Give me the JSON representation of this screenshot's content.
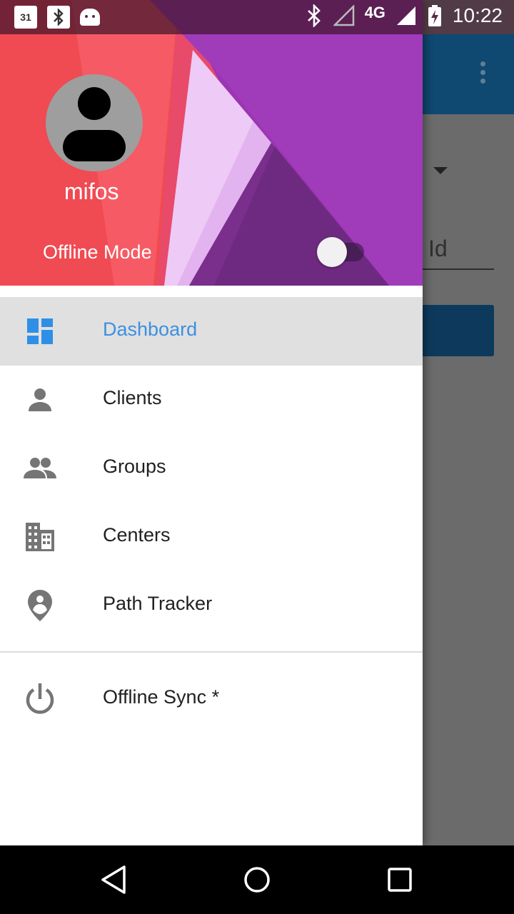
{
  "status_bar": {
    "time": "10:22",
    "network": "4G",
    "left_icons": [
      "calendar-icon",
      "bluetooth-icon",
      "android-icon"
    ],
    "calendar_day": "31",
    "bluetooth_glyph": "✱"
  },
  "background_app": {
    "input_text": "Id"
  },
  "drawer": {
    "header": {
      "username": "mifos",
      "offline_mode_label": "Offline Mode",
      "offline_mode_enabled": false
    },
    "items": [
      {
        "label": "Dashboard",
        "icon": "dashboard-icon",
        "active": true
      },
      {
        "label": "Clients",
        "icon": "person-icon",
        "active": false
      },
      {
        "label": "Groups",
        "icon": "group-icon",
        "active": false
      },
      {
        "label": "Centers",
        "icon": "building-icon",
        "active": false
      },
      {
        "label": "Path Tracker",
        "icon": "location-pin-icon",
        "active": false
      }
    ],
    "footer_items": [
      {
        "label": "Offline Sync *",
        "icon": "power-icon"
      }
    ]
  },
  "colors": {
    "accent": "#3d8fe0",
    "toolbar": "#0f4870",
    "active_row": "#e0e0e0"
  }
}
